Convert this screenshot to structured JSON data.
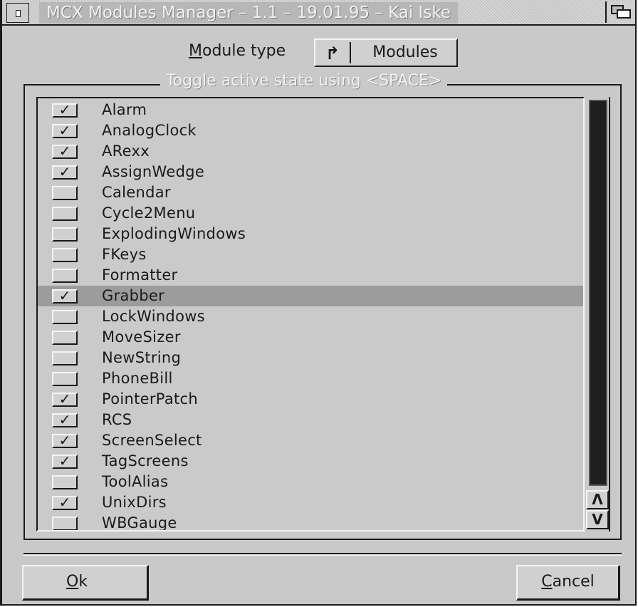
{
  "window": {
    "title": "MCX Modules Manager – 1.1 – 19.01.95 – Kai Iske"
  },
  "module_type": {
    "label_hotkey": "M",
    "label_rest": "odule type",
    "cycle_icon": "↱",
    "value": "Modules"
  },
  "group": {
    "title": "Toggle active state using <SPACE>"
  },
  "modules": [
    {
      "name": "Alarm",
      "checked": true
    },
    {
      "name": "AnalogClock",
      "checked": true
    },
    {
      "name": "ARexx",
      "checked": true
    },
    {
      "name": "AssignWedge",
      "checked": true
    },
    {
      "name": "Calendar",
      "checked": false
    },
    {
      "name": "Cycle2Menu",
      "checked": false
    },
    {
      "name": "ExplodingWindows",
      "checked": false
    },
    {
      "name": "FKeys",
      "checked": false
    },
    {
      "name": "Formatter",
      "checked": false
    },
    {
      "name": "Grabber",
      "checked": true,
      "selected": true
    },
    {
      "name": "LockWindows",
      "checked": false
    },
    {
      "name": "MoveSizer",
      "checked": false
    },
    {
      "name": "NewString",
      "checked": false
    },
    {
      "name": "PhoneBill",
      "checked": false
    },
    {
      "name": "PointerPatch",
      "checked": true
    },
    {
      "name": "RCS",
      "checked": true
    },
    {
      "name": "ScreenSelect",
      "checked": true
    },
    {
      "name": "TagScreens",
      "checked": true
    },
    {
      "name": "ToolAlias",
      "checked": false
    },
    {
      "name": "UnixDirs",
      "checked": true
    },
    {
      "name": "WBGauge",
      "checked": false
    }
  ],
  "checkmark": "✓",
  "scroller": {
    "up_glyph": "Λ",
    "down_glyph": "V"
  },
  "buttons": {
    "ok_hotkey": "O",
    "ok_rest": "k",
    "cancel_hotkey": "C",
    "cancel_rest": "ancel"
  }
}
